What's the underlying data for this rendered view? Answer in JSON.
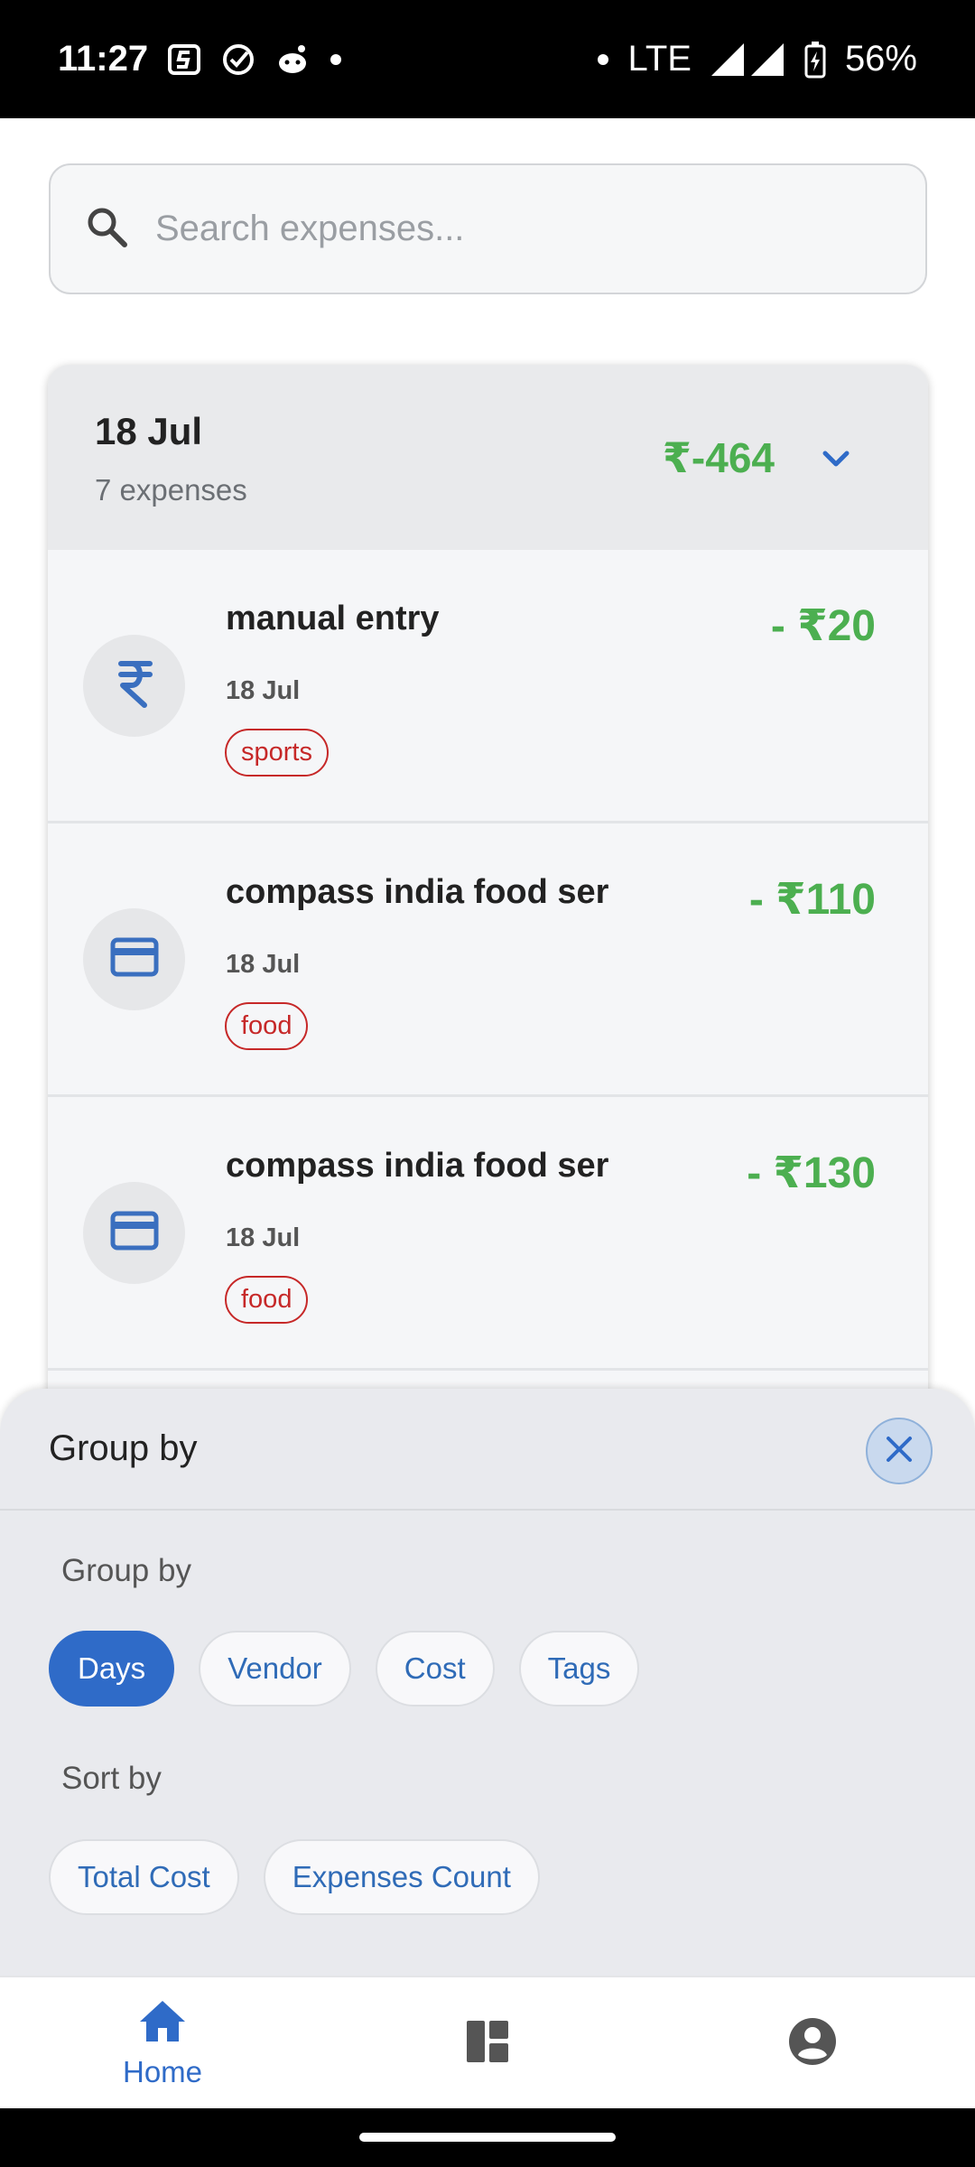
{
  "status_bar": {
    "time": "11:27",
    "network": "LTE",
    "battery": "56%"
  },
  "search": {
    "placeholder": "Search expenses..."
  },
  "day_group": {
    "title": "18 Jul",
    "count_label": "7 expenses",
    "total": "₹-464",
    "expenses": [
      {
        "name": "manual entry",
        "date": "18 Jul",
        "tag": "sports",
        "amount": "- ₹20",
        "icon": "rupee-icon"
      },
      {
        "name": "compass india food ser",
        "date": "18 Jul",
        "tag": "food",
        "amount": "- ₹110",
        "icon": "credit-card-icon"
      },
      {
        "name": "compass india food ser",
        "date": "18 Jul",
        "tag": "food",
        "amount": "- ₹130",
        "icon": "credit-card-icon"
      }
    ]
  },
  "group_sheet": {
    "title": "Group by",
    "group_label": "Group by",
    "group_options": [
      "Days",
      "Vendor",
      "Cost",
      "Tags"
    ],
    "selected_group": "Days",
    "sort_label": "Sort by",
    "sort_options": [
      "Total Cost",
      "Expenses Count"
    ]
  },
  "bottom_nav": {
    "home_label": "Home"
  },
  "colors": {
    "accent": "#2f6bc8",
    "amount_green": "#4caf50",
    "tag_red": "#c62828"
  }
}
